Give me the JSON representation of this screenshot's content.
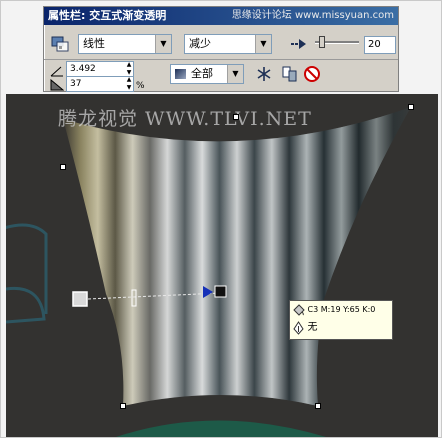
{
  "propbar": {
    "title": "属性栏: 交互式渐变透明",
    "watermark_top": "思缘设计论坛 www.missyuan.com",
    "row1": {
      "transparency_icon": "transparency-icon",
      "type_value": "线性",
      "operation_value": "减少",
      "midpoint_icon": "arrow-right-icon",
      "midpoint_level": 0.1,
      "midpoint_value": "20"
    },
    "row2": {
      "angle_value": "3.492",
      "border_value": "37",
      "percent_label": "%",
      "target_value": "全部",
      "freeze_icon": "snowflake-icon",
      "copy_icon": "copy-properties-icon",
      "clear_icon": "clear-transparency-icon"
    }
  },
  "canvas": {
    "watermark_mid": "腾龙视觉 WWW.TLVI.NET",
    "tooltip": {
      "color_label": "C3 M:19 Y:65 K:0",
      "fill_label": "无"
    }
  }
}
